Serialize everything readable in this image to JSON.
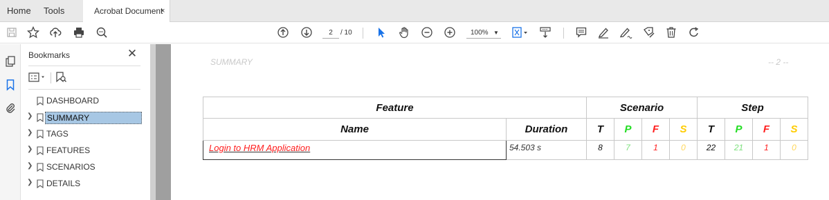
{
  "tabs": {
    "home": "Home",
    "tools": "Tools",
    "document": "Acrobat Document",
    "close": "×"
  },
  "toolbar": {
    "page_current": "2",
    "page_total": "/ 10",
    "zoom": "100%",
    "icons": [
      "save-icon",
      "star-icon",
      "upload-cloud-icon",
      "print-icon",
      "search-zoom-icon",
      "page-up-icon",
      "page-down-icon",
      "select-arrow-icon",
      "hand-icon",
      "zoom-out-icon",
      "zoom-in-icon",
      "fit-page-icon",
      "scroll-mode-icon",
      "comment-icon",
      "highlight-icon",
      "sign-icon",
      "fill-sign-icon",
      "delete-icon",
      "rotate-icon"
    ]
  },
  "bookmarks": {
    "title": "Bookmarks",
    "close": "✕",
    "items": [
      {
        "label": "DASHBOARD",
        "expandable": false,
        "selected": false
      },
      {
        "label": "SUMMARY",
        "expandable": true,
        "selected": true
      },
      {
        "label": "TAGS",
        "expandable": true,
        "selected": false
      },
      {
        "label": "FEATURES",
        "expandable": true,
        "selected": false
      },
      {
        "label": "SCENARIOS",
        "expandable": true,
        "selected": false
      },
      {
        "label": "DETAILS",
        "expandable": true,
        "selected": false
      }
    ]
  },
  "page": {
    "header": "SUMMARY",
    "page_number": "-- 2 --",
    "table": {
      "group_headers": {
        "feature": "Feature",
        "scenario": "Scenario",
        "step": "Step"
      },
      "columns": {
        "name": "Name",
        "duration": "Duration",
        "t": "T",
        "p": "P",
        "f": "F",
        "s": "S"
      },
      "rows": [
        {
          "name": "Login to HRM Application",
          "duration": "54.503 s",
          "scenario": {
            "t": "8",
            "p": "7",
            "f": "1",
            "s": "0"
          },
          "step": {
            "t": "22",
            "p": "21",
            "f": "1",
            "s": "0"
          }
        }
      ]
    }
  },
  "colors": {
    "accent_blue": "#1a73e8",
    "passed": "#22dd22",
    "failed": "#ff1e1e",
    "skipped": "#ffcc00",
    "selection": "#a7c7e4"
  }
}
